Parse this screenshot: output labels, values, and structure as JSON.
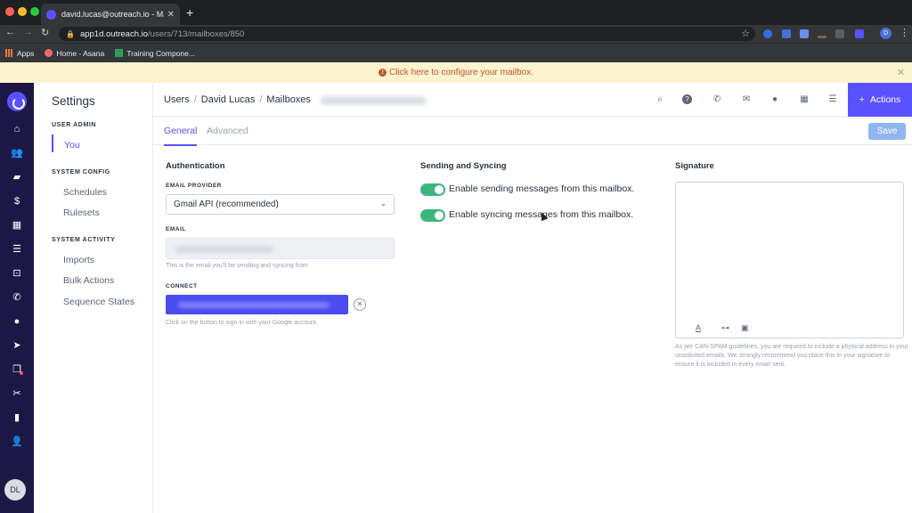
{
  "browser": {
    "tab_title": "david.lucas@outreach.io - Mai",
    "tab_close": "✕",
    "new_tab": "+",
    "url_host": "app1d.outreach.io",
    "url_path": "/users/713/mailboxes/850",
    "profile_initial": "D",
    "bookmarks": [
      "Apps",
      "Home - Asana",
      "Training Compone..."
    ]
  },
  "banner": {
    "message": "Click here to configure your mailbox.",
    "warn_glyph": "!",
    "close": "✕"
  },
  "rail": {
    "avatar_initials": "DL"
  },
  "settings_nav": {
    "title": "Settings",
    "sections": [
      {
        "label": "USER ADMIN",
        "items": [
          "You"
        ]
      },
      {
        "label": "SYSTEM CONFIG",
        "items": [
          "Schedules",
          "Rulesets"
        ]
      },
      {
        "label": "SYSTEM ACTIVITY",
        "items": [
          "Imports",
          "Bulk Actions",
          "Sequence States"
        ]
      }
    ]
  },
  "breadcrumb": [
    "Users",
    "David Lucas",
    "Mailboxes"
  ],
  "breadcrumb_sep": "/",
  "header": {
    "actions_label": "Actions",
    "actions_glyph": "+"
  },
  "tabs": {
    "general": "General",
    "advanced": "Advanced",
    "save": "Save"
  },
  "authentication": {
    "title": "Authentication",
    "email_provider_label": "EMAIL PROVIDER",
    "email_provider_value": "Gmail API (recommended)",
    "email_label": "EMAIL",
    "email_help": "This is the email you'll be sending and syncing from",
    "connect_label": "CONNECT",
    "connect_help": "Click on the button to sign in with your Google account."
  },
  "sending": {
    "title": "Sending and Syncing",
    "toggle_send": "Enable sending messages from this mailbox.",
    "toggle_sync": "Enable syncing messages from this mailbox."
  },
  "signature": {
    "title": "Signature",
    "note": "As per CAN-SPAM guidelines, you are required to include a physical address in your unsolicited emails. We strongly recommend you place this in your signature to ensure it is included in every email sent."
  },
  "colors": {
    "accent": "#5951ff",
    "rail": "#1c1845",
    "toggle_on": "#3bb77e",
    "banner_bg": "#fcf4cf",
    "banner_text": "#c4532d",
    "save_disabled": "#8fb6f2"
  }
}
